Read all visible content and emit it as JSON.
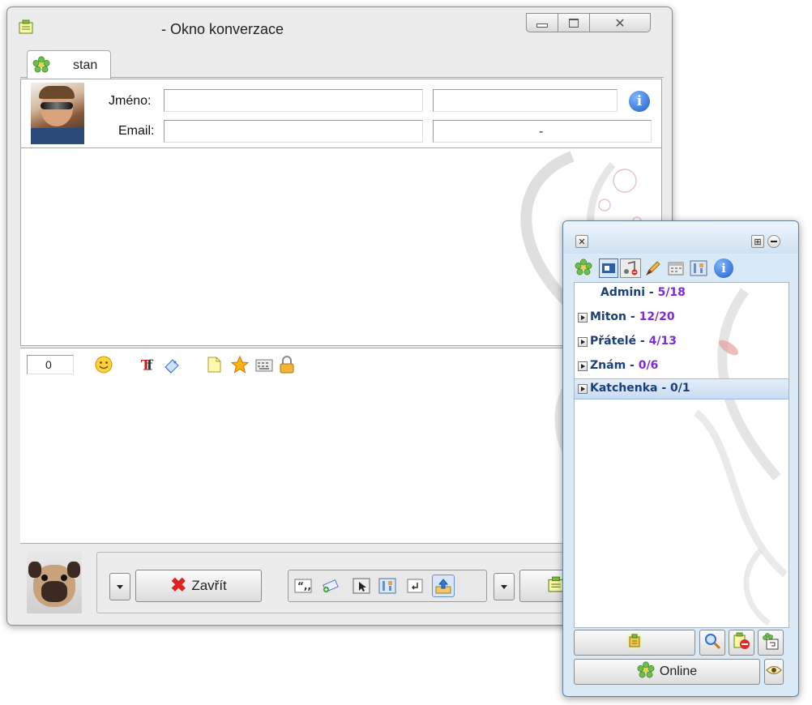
{
  "conversation_window": {
    "title": "- Okno konverzace",
    "tab_label": "stan",
    "name_label": "Jméno:",
    "email_label": "Email:",
    "email_extra_value": "-",
    "char_counter": "0",
    "close_button_label": "Zavřít"
  },
  "contact_list": {
    "groups": [
      {
        "name": "Admini - ",
        "count": "5/18",
        "expandable": false
      },
      {
        "name": "Miton - ",
        "count": "12/20",
        "expandable": true
      },
      {
        "name": "Přátelé - ",
        "count": "4/13",
        "expandable": true
      },
      {
        "name": "Znám - ",
        "count": "0/6",
        "expandable": true
      },
      {
        "name": "Katchenka - ",
        "count": "0/1",
        "expandable": true
      }
    ],
    "status_label": "Online",
    "selected_group": "Katchenka - 0/1"
  },
  "colors": {
    "accent": "#2b6fd6",
    "count_purple": "#7c2bd8",
    "group_text": "#1b3f7a",
    "selection": "#c8dcf2"
  }
}
